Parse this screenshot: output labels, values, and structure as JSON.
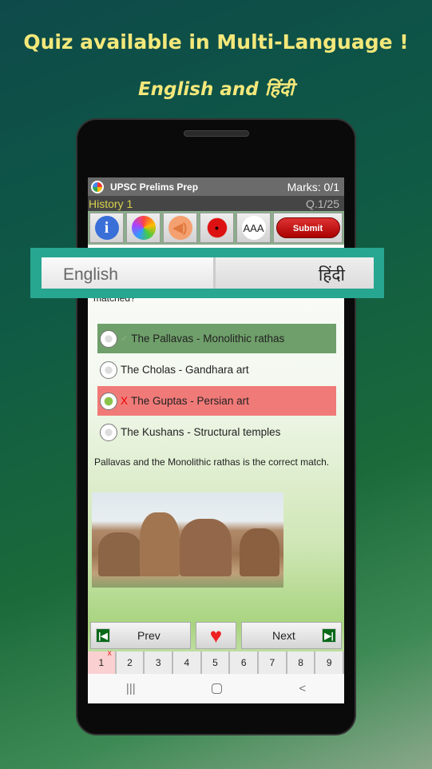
{
  "promo": {
    "headline": "Quiz available in Multi-Language !",
    "subheadline": "English and  हिंदी"
  },
  "app": {
    "title": "UPSC Prelims Prep",
    "marks": "Marks: 0/1",
    "subject": "History 1",
    "question_counter": "Q.1/25"
  },
  "toolbar": {
    "icons": [
      "info-icon",
      "photos-icon",
      "speaker-icon",
      "ladybug-icon",
      "font-size-icon"
    ],
    "font_label": "AAA",
    "submit_label": "Submit"
  },
  "language": {
    "options": [
      "English",
      "हिंदी"
    ]
  },
  "question": {
    "partial_text": "matched?"
  },
  "options": [
    {
      "mark": "✓",
      "text": "The Pallavas - Monolithic rathas",
      "state": "correct",
      "color": "#6f9f6a"
    },
    {
      "mark": "",
      "text": "The Cholas - Gandhara art",
      "state": "none"
    },
    {
      "mark": "X",
      "text": "The Guptas - Persian art",
      "state": "wrong-selected",
      "color": "#f07a78"
    },
    {
      "mark": "",
      "text": "The Kushans - Structural temples",
      "state": "none"
    }
  ],
  "explanation": "Pallavas and the Monolithic rathas is the correct match.",
  "nav": {
    "prev": "Prev",
    "next": "Next"
  },
  "question_numbers": [
    "1",
    "2",
    "3",
    "4",
    "5",
    "6",
    "7",
    "8",
    "9"
  ],
  "current_question_mark": "x"
}
